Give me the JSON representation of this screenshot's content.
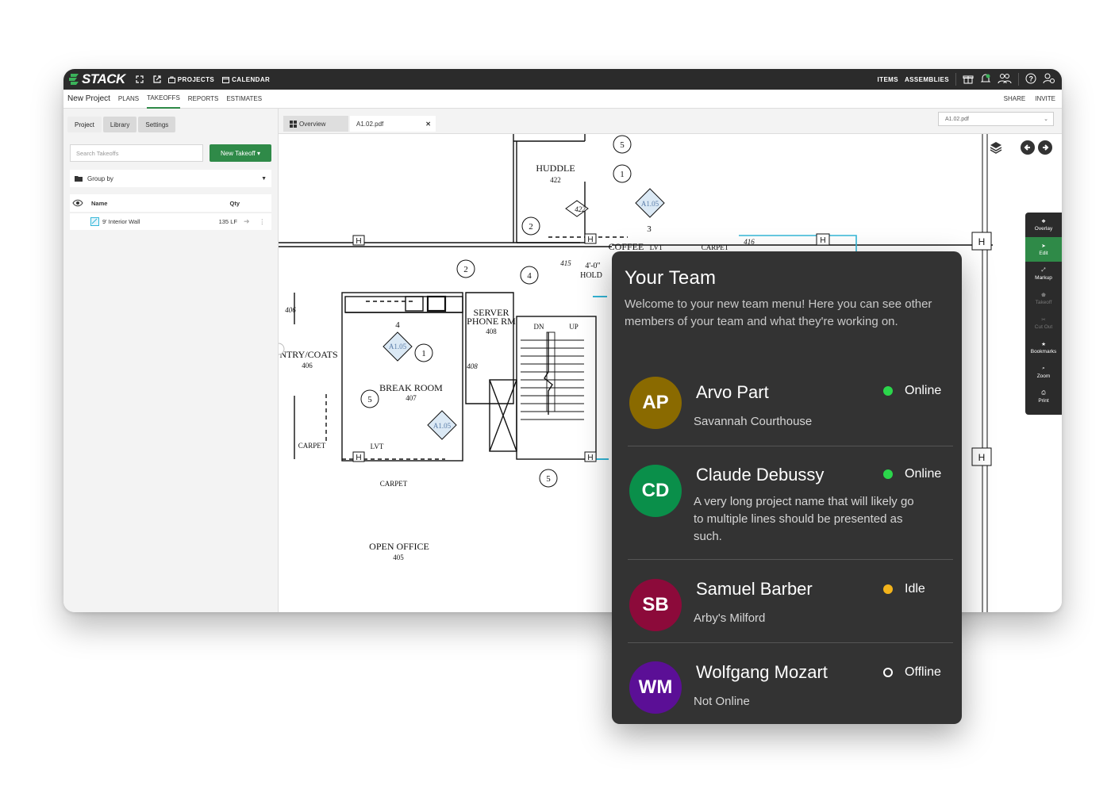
{
  "app": {
    "logo": "STACK",
    "nav": {
      "projects": "PROJECTS",
      "calendar": "CALENDAR",
      "items": "ITEMS",
      "assemblies": "ASSEMBLIES"
    },
    "project_name": "New Project",
    "subnav": [
      "PLANS",
      "TAKEOFFS",
      "REPORTS",
      "ESTIMATES"
    ],
    "active_subnav": "TAKEOFFS",
    "share": "SHARE",
    "invite": "INVITE",
    "accent": "#2f8a48"
  },
  "sidebar": {
    "tabs": [
      "Project",
      "Library",
      "Settings"
    ],
    "search_placeholder": "Search Takeoffs",
    "new_takeoff": "New Takeoff ▾",
    "group_by": "Group by",
    "col_name": "Name",
    "col_qty": "Qty",
    "rows": [
      {
        "name": "9' Interior Wall",
        "qty": "135 LF"
      }
    ]
  },
  "viewer": {
    "tabs": [
      "Overview",
      "A1.02.pdf"
    ],
    "sheet_select": "A1.02.pdf",
    "tools": [
      "Overlay",
      "Edit",
      "Markup",
      "Takeoff",
      "Cut Out",
      "Bookmarks",
      "Zoom",
      "Print"
    ],
    "drawing_labels": {
      "huddle": "HUDDLE",
      "huddle_num": "422",
      "server": "SERVER",
      "phone_rm": "PHONE RM",
      "server_num": "408",
      "break_room": "BREAK ROOM",
      "break_num": "407",
      "entry": "NTRY/COATS",
      "entry_num": "406",
      "open_office": "OPEN OFFICE",
      "open_num": "405",
      "coffee": "COFFEE",
      "lvt": "LVT",
      "carpet": "CARPET",
      "hold": "HOLD",
      "dim": "4'-0\"",
      "dn": "DN",
      "up": "UP",
      "ref": "A1.05",
      "h": "H",
      "tag_5": "5",
      "tag_1": "1",
      "tag_2": "2",
      "tag_3": "3",
      "tag_4": "4",
      "tag_422": "422",
      "tag_415": "415",
      "tag_406": "406",
      "tag_408": "408",
      "tag_416": "416"
    }
  },
  "team_panel": {
    "title": "Your Team",
    "intro": "Welcome to your new team menu! Here you can see other members of your team and what they're working on.",
    "members": [
      {
        "initials": "AP",
        "name": "Arvo Part",
        "project": "Savannah Courthouse",
        "status": "Online",
        "avatar_color": "#8a6a00",
        "status_color": "#2bd64b"
      },
      {
        "initials": "CD",
        "name": "Claude Debussy",
        "project": "A very long project name that will likely go to multiple lines should be presented as such.",
        "status": "Online",
        "avatar_color": "#0a8f4a",
        "status_color": "#2bd64b"
      },
      {
        "initials": "SB",
        "name": "Samuel Barber",
        "project": "Arby's Milford",
        "status": "Idle",
        "avatar_color": "#8c0a3a",
        "status_color": "#f3b41b"
      },
      {
        "initials": "WM",
        "name": "Wolfgang Mozart",
        "project": "Not Online",
        "status": "Offline",
        "avatar_color": "#5b0f96",
        "status_color": "transparent"
      }
    ]
  }
}
